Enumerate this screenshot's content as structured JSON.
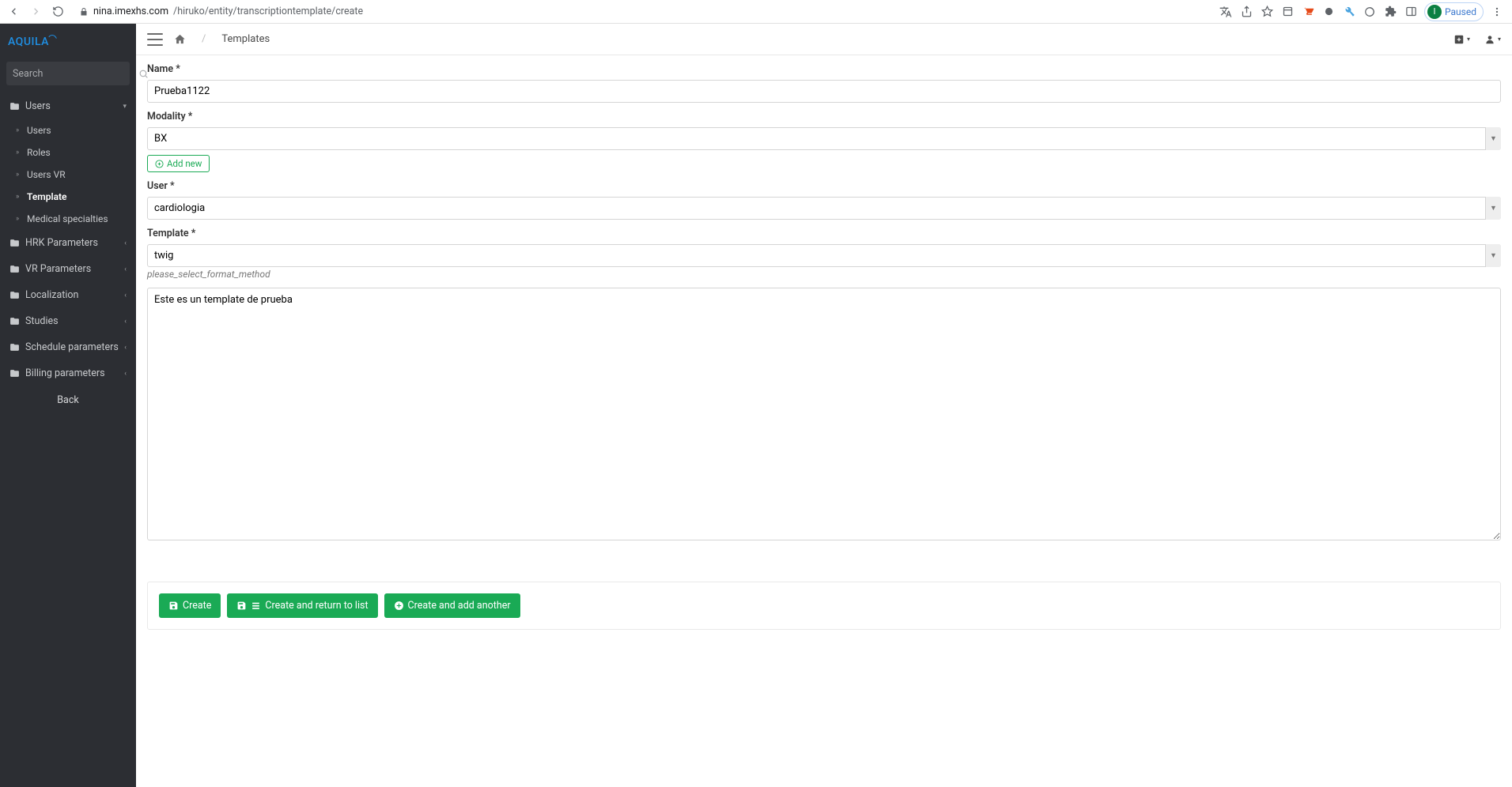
{
  "chrome": {
    "url_domain": "nina.imexhs.com",
    "url_path": "/hiruko/entity/transcriptiontemplate/create",
    "paused_label": "Paused",
    "avatar_initial": "I"
  },
  "brand": "AQUILA",
  "search_placeholder": "Search",
  "sidebar": {
    "groups": [
      {
        "label": "Users",
        "open": true,
        "caret": "down",
        "items": [
          {
            "label": "Users"
          },
          {
            "label": "Roles"
          },
          {
            "label": "Users VR"
          },
          {
            "label": "Template",
            "active": true
          },
          {
            "label": "Medical specialties"
          }
        ]
      },
      {
        "label": "HRK Parameters",
        "caret": "left"
      },
      {
        "label": "VR Parameters",
        "caret": "left"
      },
      {
        "label": "Localization",
        "caret": "left"
      },
      {
        "label": "Studies",
        "caret": "left"
      },
      {
        "label": "Schedule parameters",
        "caret": "left"
      },
      {
        "label": "Billing parameters",
        "caret": "left"
      }
    ],
    "back_label": "Back"
  },
  "breadcrumb": {
    "page": "Templates"
  },
  "form": {
    "name_label": "Name *",
    "name_value": "Prueba1122",
    "modality_label": "Modality *",
    "modality_value": "BX",
    "add_new_label": "Add new",
    "user_label": "User *",
    "user_value": "cardiologia",
    "template_label": "Template *",
    "template_value": "twig",
    "template_helper": "please_select_format_method",
    "body_value": "Este es un template de prueba"
  },
  "actions": {
    "create": "Create",
    "create_return": "Create and return to list",
    "create_another": "Create and add another"
  }
}
